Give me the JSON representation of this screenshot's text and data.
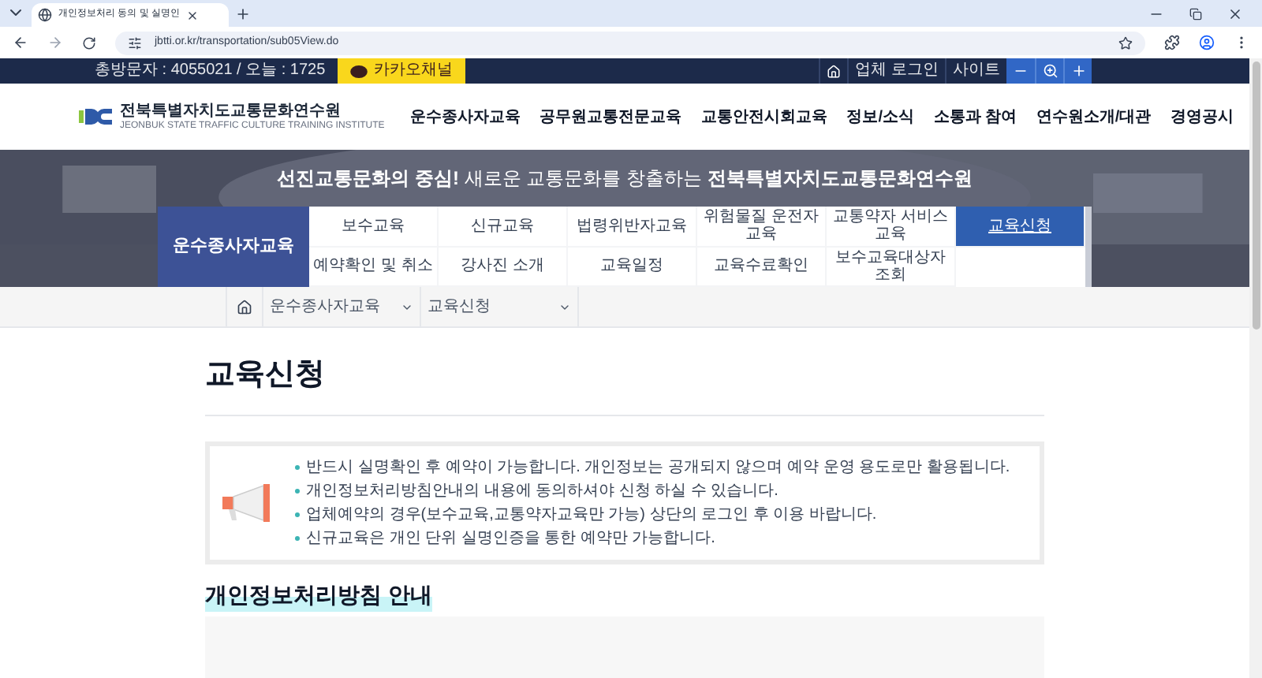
{
  "browser": {
    "tab_title": "개인정보처리 동의 및 실명인",
    "url": "jbtti.or.kr/transportation/sub05View.do"
  },
  "topbar": {
    "visitors": "총방문자 : 4055021 / 오늘 : 1725",
    "kakao": "카카오채널",
    "login": "업체 로그인",
    "sitemap": "사이트"
  },
  "header": {
    "logo_title": "전북특별자치도교통문화연수원",
    "logo_subtitle": "JEONBUK STATE TRAFFIC CULTURE TRAINING INSTITUTE",
    "nav": [
      "운수종사자교육",
      "공무원교통전문교육",
      "교통안전시회교육",
      "정보/소식",
      "소통과 참여",
      "연수원소개/대관",
      "경영공시"
    ]
  },
  "banner": {
    "slogan": "**선진교통문화의 중심!** 새로운 교통문화를 창출하는 **전북특별자치도교통문화연수원**"
  },
  "submenu": {
    "title": "운수종사자교육",
    "items": [
      {
        "label": "보수교육",
        "selected": false
      },
      {
        "label": "신규교육",
        "selected": false
      },
      {
        "label": "법령위반자교육",
        "selected": false
      },
      {
        "label": "위험물질 운전자 교육",
        "selected": false
      },
      {
        "label": "교통약자 서비스교육",
        "selected": false
      },
      {
        "label": "교육신청",
        "selected": true
      },
      {
        "label": "예약확인 및 취소",
        "selected": false
      },
      {
        "label": "강사진 소개",
        "selected": false
      },
      {
        "label": "교육일정",
        "selected": false
      },
      {
        "label": "교육수료확인",
        "selected": false
      },
      {
        "label": "보수교육대상자조회",
        "selected": false
      }
    ]
  },
  "breadcrumb": [
    "운수종사자교육",
    "교육신청"
  ],
  "page_title": "교육신청",
  "notices": [
    "반드시 실명확인 후 예약이 가능합니다. 개인정보는 공개되지 않으며 예약 운영 용도로만 활용됩니다.",
    "개인정보처리방침안내의 내용에 동의하셔야 신청 하실 수 있습니다.",
    "업체예약의 경우(보수교육,교통약자교육만 가능) 상단의 로그인 후 이용 바랍니다.",
    "신규교육은 개인 단위 실명인증을 통한 예약만 가능합니다."
  ],
  "section_heading": "개인정보처리방침 안내"
}
